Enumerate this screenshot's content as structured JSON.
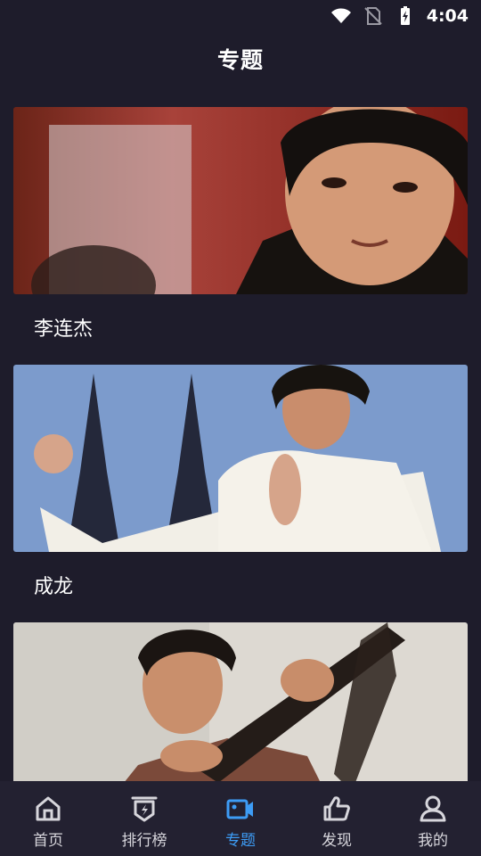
{
  "status_bar": {
    "time": "4:04",
    "icons": [
      "wifi-icon",
      "no-sim-icon",
      "battery-charging-icon"
    ]
  },
  "header": {
    "title": "专题"
  },
  "topics": [
    {
      "label": "李连杰",
      "image_icon": "topic-photo"
    },
    {
      "label": "成龙",
      "image_icon": "topic-photo"
    },
    {
      "label": "",
      "image_icon": "topic-photo"
    }
  ],
  "tab_bar": {
    "active": "专题",
    "accent_color": "#3d9cf5",
    "items": [
      {
        "label": "首页",
        "icon": "home-icon"
      },
      {
        "label": "排行榜",
        "icon": "ranking-icon"
      },
      {
        "label": "专题",
        "icon": "video-camera-icon"
      },
      {
        "label": "发现",
        "icon": "thumbs-up-icon"
      },
      {
        "label": "我的",
        "icon": "user-icon"
      }
    ]
  }
}
